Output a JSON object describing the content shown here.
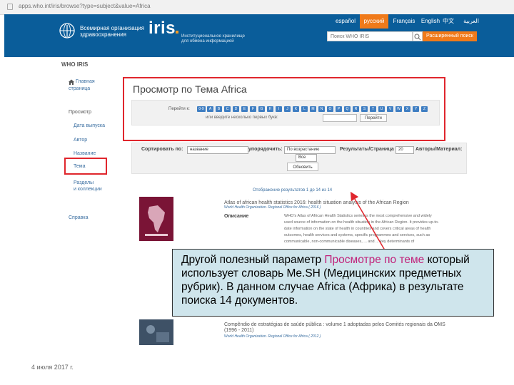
{
  "browser": {
    "url": "apps.who.int/iris/browse?type=subject&value=Africa"
  },
  "header": {
    "org_line1": "Всемирная организация",
    "org_line2": "здравоохранения",
    "logo_text": "iris",
    "logo_sub_line1": "Институциональное хранилище",
    "logo_sub_line2": "для обмена информацией"
  },
  "languages": [
    {
      "label": "español",
      "active": false
    },
    {
      "label": "русский",
      "active": true
    },
    {
      "label": "Français",
      "active": false
    },
    {
      "label": "English",
      "active": false
    },
    {
      "label": "中文",
      "active": false
    },
    {
      "label": "العربية",
      "active": false
    }
  ],
  "search": {
    "placeholder": "Поиск WHO IRIS",
    "advanced_label": "Расширенный поиск"
  },
  "sidebar": {
    "heading": "WHO IRIS",
    "home_line1": "Главная",
    "home_line2": "страница",
    "browse_label": "Просмотр",
    "items": [
      {
        "label": "Дата выпуска"
      },
      {
        "label": "Автор"
      },
      {
        "label": "Название"
      },
      {
        "label": "Тема"
      }
    ],
    "collections_line1": "Разделы",
    "collections_line2": "и коллекции",
    "help_label": "Справка"
  },
  "browse": {
    "title": "Просмотр по Тема Africa",
    "jump_label": "Перейти к:",
    "letters": [
      "0-9",
      "A",
      "B",
      "C",
      "D",
      "E",
      "F",
      "G",
      "H",
      "I",
      "J",
      "K",
      "L",
      "M",
      "N",
      "O",
      "P",
      "Q",
      "R",
      "S",
      "T",
      "U",
      "V",
      "W",
      "X",
      "Y",
      "Z"
    ],
    "first_letters_label": "или введите несколько первых букв:",
    "go_label": "Перейти"
  },
  "sort": {
    "sort_by_label": "Сортировать по:",
    "sort_by_value": "название",
    "order_label": "упорядочить:",
    "order_value": "По возрастанию",
    "rpp_label": "Результаты/Страница",
    "rpp_value": "20",
    "authors_label": "Авторы/Материал:",
    "authors_value": "Все",
    "update_label": "Обновить"
  },
  "results": {
    "count_text": "Отображение результатов 1 до 14 из 14",
    "item1": {
      "title": "Atlas of african health statistics 2016: health situation analysis of the African Region",
      "publisher": "World Health Organization. Regional Office for Africa ( 2016 )",
      "description_label": "Описание",
      "description_lines": [
        "WHO's Atlas of African Health Statistics series is the most comprehensive and widely",
        "used source of information on the health situation in the African Region. It provides up-to-",
        "date information on the state of health in countries and covers critical areas of health",
        "outcomes, health services and systems, specific programmes and services, such as",
        "communicable, non-communicable diseases, ... and ... key determinants of"
      ]
    },
    "item2": {
      "title_line1": "Compêndio de estratégias de saúde pública : volume 1 adoptadas pelos Comités regionais da OMS",
      "title_line2": "(1996 - 2011)",
      "publisher": "World Health Organization. Regional Office for Africa ( 2012 )"
    }
  },
  "callout": {
    "pre": "Другой полезный параметр ",
    "highlight": "Просмотре по теме",
    "post": " который использует словарь Me.SH (Медицинских предметных рубрик).  В данном случае Africa (Африка) в результате поиска 14 документов."
  },
  "footer": {
    "date": "4 июля 2017 г."
  },
  "colors": {
    "header_blue": "#0a5d9a",
    "accent_orange": "#f07a1a",
    "highlight_red": "#e0262d",
    "link_blue": "#3b6fa1",
    "callout_bg": "#cfe5ec",
    "callout_highlight": "#c1227a"
  }
}
